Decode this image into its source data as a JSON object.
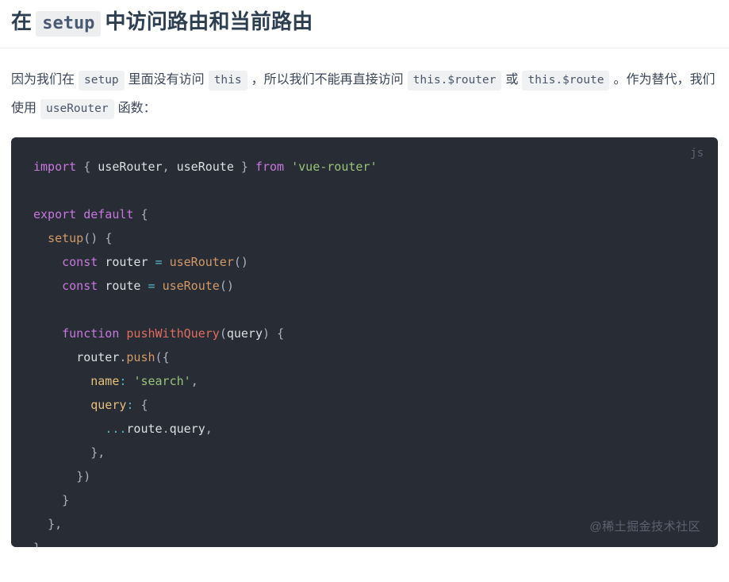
{
  "heading": {
    "before": "在",
    "chip": "setup",
    "after": "中访问路由和当前路由"
  },
  "paragraph": {
    "seg1": "因为我们在",
    "code1": "setup",
    "seg2": "里面没有访问",
    "code2": "this",
    "seg3": "，所以我们不能再直接访问",
    "code3": "this.$router",
    "seg4": "或",
    "code4": "this.$route",
    "seg5": "。作为替代，我们使用",
    "code5": "useRouter",
    "seg6": "函数："
  },
  "code_block": {
    "language_label": "js",
    "watermark": "@稀土掘金技术社区",
    "background": "#282c35",
    "lines": [
      "import { useRouter, useRoute } from 'vue-router'",
      "",
      "export default {",
      "  setup() {",
      "    const router = useRouter()",
      "    const route = useRoute()",
      "",
      "    function pushWithQuery(query) {",
      "      router.push({",
      "        name: 'search',",
      "        query: {",
      "          ...route.query,",
      "        },",
      "      })",
      "    }",
      "  },",
      "}"
    ]
  },
  "colors": {
    "heading_text": "#2c3e50",
    "chip_bg": "#eceef0",
    "chip_text": "#4a5a73",
    "body_text": "#3b4758",
    "code_bg": "#282c35",
    "code_text": "#abb2bf",
    "keyword": "#c678dd",
    "function": "#e06c5f",
    "string": "#98c379",
    "property": "#e5c07b",
    "value": "#d19a66",
    "operator": "#56b6c2",
    "lang_label": "#5a6274",
    "watermark": "#5c6270",
    "divider": "#ebedef"
  }
}
